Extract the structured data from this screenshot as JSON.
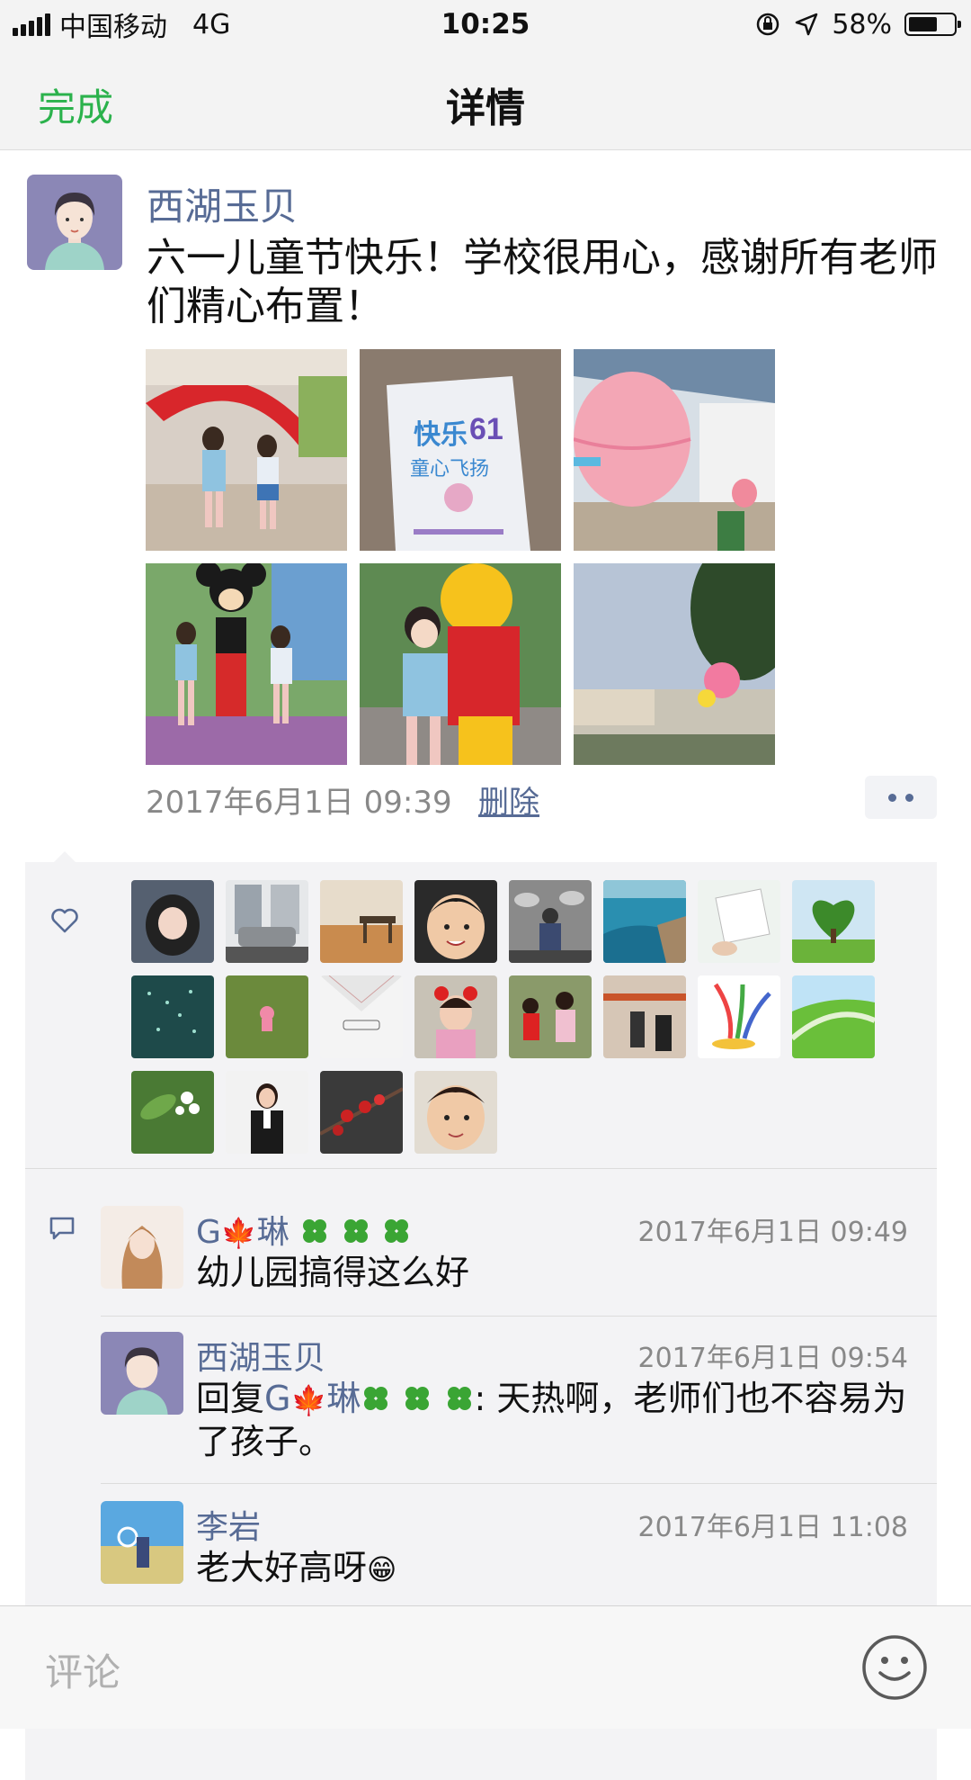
{
  "status_bar": {
    "carrier": "中国移动",
    "network": "4G",
    "time": "10:25",
    "battery": "58%",
    "battery_level": 0.58,
    "icons": [
      "signal-icon",
      "orientation-lock-icon",
      "location-arrow-icon",
      "battery-icon"
    ]
  },
  "nav": {
    "done_label": "完成",
    "title": "详情"
  },
  "post": {
    "author": "西湖玉贝",
    "text": "六一儿童节快乐！学校很用心，感谢所有老师们精心布置！",
    "photo_count": 6,
    "time": "2017年6月1日 09:39",
    "delete_label": "删除"
  },
  "likes": {
    "icon": "heart-outline-icon",
    "count": 20
  },
  "comments": [
    {
      "name": "G琳",
      "time": "2017年6月1日 09:49",
      "text": "幼儿园搞得这么好"
    },
    {
      "name": "西湖玉贝",
      "time": "2017年6月1日 09:54",
      "reply_prefix": "回复",
      "reply_to": "G琳",
      "text": ": 天热啊，老师们也不容易为了孩子。"
    },
    {
      "name": "李岩",
      "time": "2017年6月1日 11:08",
      "text": "老大好高呀",
      "emoji": "😁"
    }
  ],
  "comment_bar": {
    "placeholder": "评论",
    "emoji_icon": "smiley-face-icon"
  }
}
